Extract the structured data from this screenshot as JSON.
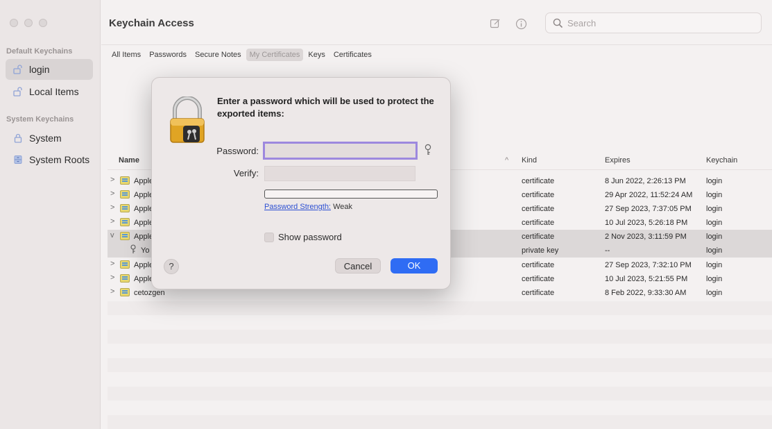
{
  "app": {
    "title": "Keychain Access"
  },
  "search": {
    "placeholder": "Search"
  },
  "sidebar": {
    "default_section": "Default Keychains",
    "system_section": "System Keychains",
    "items": [
      {
        "label": "login",
        "icon": "unlocked-lock-icon"
      },
      {
        "label": "Local Items",
        "icon": "unlocked-lock-icon"
      },
      {
        "label": "System",
        "icon": "lock-icon"
      },
      {
        "label": "System Roots",
        "icon": "cabinet-icon"
      }
    ]
  },
  "tabs": [
    "All Items",
    "Passwords",
    "Secure Notes",
    "My Certificates",
    "Keys",
    "Certificates"
  ],
  "table": {
    "headers": {
      "name": "Name",
      "kind": "Kind",
      "expires": "Expires",
      "keychain": "Keychain"
    },
    "rows": [
      {
        "name": "Apple",
        "kind": "certificate",
        "expires": "8 Jun 2022, 2:26:13 PM",
        "keychain": "login"
      },
      {
        "name": "Apple",
        "kind": "certificate",
        "expires": "29 Apr 2022, 11:52:24 AM",
        "keychain": "login"
      },
      {
        "name": "Apple",
        "kind": "certificate",
        "expires": "27 Sep 2023, 7:37:05 PM",
        "keychain": "login"
      },
      {
        "name": "Apple",
        "kind": "certificate",
        "expires": "10 Jul 2023, 5:26:18 PM",
        "keychain": "login"
      },
      {
        "name": "Apple",
        "kind": "certificate",
        "expires": "2 Nov 2023, 3:11:59 PM",
        "keychain": "login"
      },
      {
        "name": "Yo",
        "kind": "private key",
        "expires": "--",
        "keychain": "login"
      },
      {
        "name": "Apple",
        "kind": "certificate",
        "expires": "27 Sep 2023, 7:32:10 PM",
        "keychain": "login"
      },
      {
        "name": "Apple",
        "kind": "certificate",
        "expires": "10 Jul 2023, 5:21:55 PM",
        "keychain": "login"
      },
      {
        "name": "cetozgen",
        "kind": "certificate",
        "expires": "8 Feb 2022, 9:33:30 AM",
        "keychain": "login"
      }
    ]
  },
  "dialog": {
    "message": "Enter a password which will be used to protect the exported items:",
    "password_label": "Password:",
    "verify_label": "Verify:",
    "password_value": "",
    "verify_value": "",
    "strength_label": "Password Strength:",
    "strength_value": "Weak",
    "show_password": "Show password",
    "cancel": "Cancel",
    "ok": "OK",
    "help": "?"
  },
  "colors": {
    "accent": "#2f6cf4",
    "focus_ring": "#9d88de",
    "link": "#2c4fd2"
  }
}
